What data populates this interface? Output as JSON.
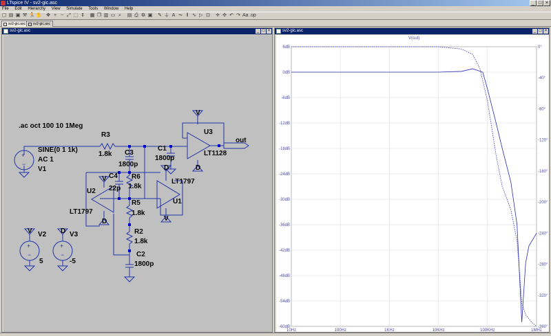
{
  "app": {
    "title": "LTspice IV - sv2-gic.asc"
  },
  "menu": [
    "File",
    "Edit",
    "Hierarchy",
    "View",
    "Simulate",
    "Tools",
    "Window",
    "Help"
  ],
  "tabs": [
    "sv2-gic.asc",
    "sv2-gic.asc"
  ],
  "toolbar_icons": [
    "new-icon",
    "open-icon",
    "save-icon",
    "wrench-icon",
    "run-icon",
    "halt-icon",
    "pan-icon",
    "zoom-in-icon",
    "zoom-out-icon",
    "zoom-fit-icon",
    "zoom-area-icon",
    "autorange-icon",
    "schematic-icon",
    "cascade-icon",
    "tile-icon",
    "spice-dir-icon",
    "find-icon",
    "print-setup-icon",
    "print-icon",
    "copy-icon",
    "paste-icon",
    "wire-icon",
    "ground-icon",
    "label-icon",
    "resistor-icon",
    "capacitor-icon",
    "inductor-icon",
    "diode-icon",
    "component-icon",
    "move-icon",
    "drag-icon",
    "undo-icon",
    "redo-icon",
    "text-icon",
    "spice-icon"
  ],
  "schematic": {
    "window_title": "sv2-gic.asc",
    "directive": ".ac oct 100 10 1Meg",
    "v1": {
      "name": "V1",
      "value": "SINE(0 1 1k)",
      "ac": "AC 1"
    },
    "v2": {
      "name": "V2",
      "value": "5",
      "pin": "V"
    },
    "v3": {
      "name": "V3",
      "value": "-5",
      "pin": "D"
    },
    "r3": {
      "name": "R3",
      "value": "1.8k"
    },
    "c3": {
      "name": "C3",
      "value": "1800p"
    },
    "c1": {
      "name": "C1",
      "value": "1800p"
    },
    "c4": {
      "name": "C4",
      "value": "22p"
    },
    "r6": {
      "name": "R6",
      "value": "1.8k"
    },
    "r5": {
      "name": "R5",
      "value": "1.8k"
    },
    "r2": {
      "name": "R2",
      "value": "1.8k"
    },
    "c2": {
      "name": "C2",
      "value": "1800p"
    },
    "u1": {
      "name": "U1",
      "model": "LT1797"
    },
    "u2": {
      "name": "U2",
      "model": "LT1797"
    },
    "u3": {
      "name": "U3",
      "model": "LT1128"
    },
    "out_label": "out",
    "supply_pin_pos": "V",
    "supply_pin_neg": "D"
  },
  "plot": {
    "window_title": "sv2-gic.asc",
    "trace_name": "V(out)",
    "left_ticks": [
      "6dB",
      "0dB",
      "-6dB",
      "-12dB",
      "-18dB",
      "-24dB",
      "-30dB",
      "-36dB",
      "-42dB",
      "-48dB",
      "-54dB",
      "-60dB"
    ],
    "right_ticks": [
      "0°",
      "-40°",
      "-80°",
      "-120°",
      "-160°",
      "-200°",
      "-240°",
      "-280°",
      "-320°",
      "-360°"
    ],
    "x_ticks": [
      "10Hz",
      "100Hz",
      "1KHz",
      "10KHz",
      "100KHz",
      "1MHz"
    ]
  },
  "chart_data": {
    "type": "line",
    "title": "V(out)",
    "xscale": "log",
    "xlim": [
      10,
      1000000
    ],
    "ylim": [
      -60,
      6
    ],
    "y2lim": [
      -360,
      0
    ],
    "series": [
      {
        "name": "V(out)",
        "axis": "magnitude_dB",
        "style": "solid",
        "x": [
          10,
          100,
          1000,
          10000,
          30000,
          50000,
          80000,
          100000,
          150000,
          200000,
          300000,
          400000,
          450000,
          500000,
          600000,
          700000,
          1000000
        ],
        "y": [
          0,
          0,
          0,
          0,
          0.2,
          0.8,
          0,
          -4,
          -12,
          -18,
          -26,
          -36,
          -48,
          -59,
          -45,
          -41,
          -38
        ]
      },
      {
        "axis": "phase_deg",
        "style": "dashed",
        "x": [
          10,
          100,
          1000,
          10000,
          30000,
          50000,
          70000,
          100000,
          150000,
          200000,
          300000,
          400000,
          450000,
          500000,
          600000,
          800000,
          1000000
        ],
        "y": [
          0,
          0,
          0,
          0,
          -3,
          -10,
          -28,
          -70,
          -140,
          -180,
          -210,
          -250,
          -290,
          -330,
          -345,
          -355,
          -360
        ]
      }
    ],
    "colors": {
      "trace": "#2a2ab0",
      "grid": "#d8d8d8"
    }
  }
}
